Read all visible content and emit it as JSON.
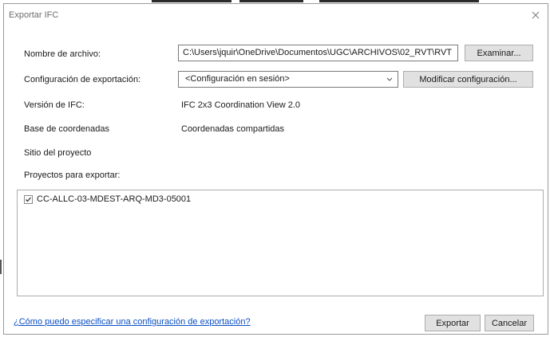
{
  "dialog": {
    "title": "Exportar IFC",
    "close_icon": "close-icon"
  },
  "file_name": {
    "label": "Nombre de archivo:",
    "value": "C:\\Users\\jquir\\OneDrive\\Documentos\\UGC\\ARCHIVOS\\02_RVT\\RVT",
    "browse_label": "Examinar..."
  },
  "export_config": {
    "label": "Configuración de exportación:",
    "selected": "<Configuración en sesión>",
    "modify_label": "Modificar configuración..."
  },
  "ifc_version": {
    "label": "Versión de IFC:",
    "value": "IFC 2x3 Coordination View 2.0"
  },
  "coordinate_base": {
    "label": "Base de coordenadas",
    "value": "Coordenadas compartidas"
  },
  "project_site": {
    "label": "Sitio del proyecto"
  },
  "projects": {
    "label": "Proyectos para exportar:",
    "items": [
      {
        "name": "CC-ALLC-03-MDEST-ARQ-MD3-05001",
        "checked": true
      }
    ]
  },
  "footer": {
    "help_link": "¿Cómo puedo especificar una configuración de exportación?",
    "export_label": "Exportar",
    "cancel_label": "Cancelar"
  }
}
